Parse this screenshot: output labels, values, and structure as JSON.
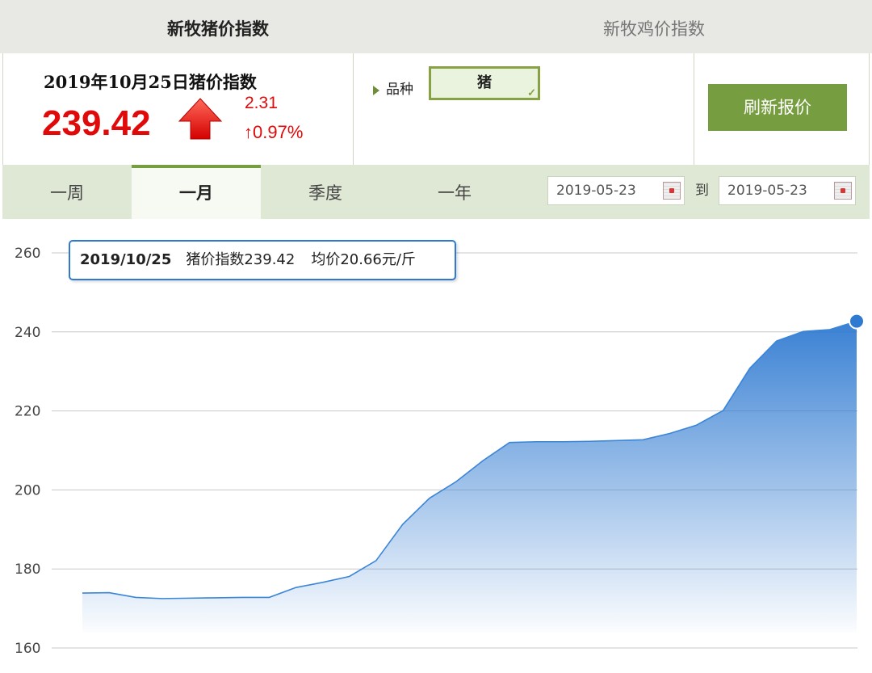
{
  "top_tabs": {
    "active": "新牧猪价指数",
    "inactive": "新牧鸡价指数"
  },
  "summary": {
    "title": "2019年10月25日猪价指数",
    "index_value": "239.42",
    "change_value": "2.31",
    "change_percent": "↑0.97%",
    "variety_label": "品种",
    "variety_value": "猪",
    "refresh_label": "刷新报价",
    "colors": {
      "up": "#e00a0a",
      "accent": "#769d3f"
    }
  },
  "period_tabs": [
    "一周",
    "一月",
    "季度",
    "一年"
  ],
  "active_period": "一月",
  "date_range": {
    "from": "2019-05-23",
    "to_label": "到",
    "to": "2019-05-23"
  },
  "tooltip": {
    "date": "2019/10/25",
    "index_text": "猪价指数239.42",
    "avg_text": "均价20.66元/斤"
  },
  "chart_data": {
    "type": "area",
    "ylim": [
      160,
      260
    ],
    "yticks": [
      160,
      180,
      200,
      220,
      240,
      260
    ],
    "grid": true,
    "series": [
      {
        "values": [
          173.9,
          174.0,
          172.8,
          172.5,
          172.6,
          172.7,
          172.8,
          172.8,
          175.3,
          176.6,
          178.1,
          182.1,
          191.3,
          197.9,
          202.1,
          207.4,
          212.0,
          212.2,
          212.2,
          212.3,
          212.5,
          212.7,
          214.3,
          216.4,
          220.1,
          230.8,
          237.7,
          240.1,
          240.6,
          242.7
        ],
        "color": "#3a85d8"
      }
    ]
  }
}
